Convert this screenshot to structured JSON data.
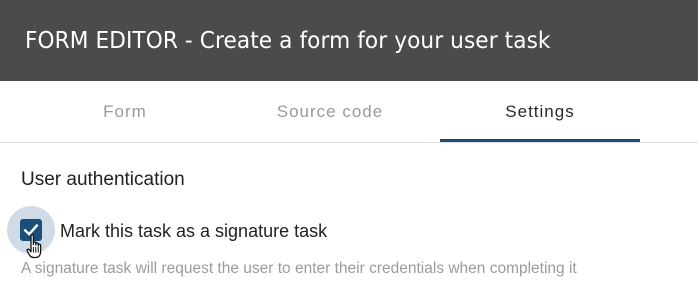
{
  "header": {
    "title": "FORM EDITOR - Create a form for your user task"
  },
  "tabs": [
    {
      "label": "Form",
      "active": false
    },
    {
      "label": "Source code",
      "active": false
    },
    {
      "label": "Settings",
      "active": true
    }
  ],
  "settings": {
    "section_title": "User authentication",
    "signature_checkbox": {
      "label": "Mark this task as a signature task",
      "checked": true,
      "helper": "A signature task will request the user to enter their credentials when completing it"
    }
  },
  "colors": {
    "header_bg": "#4b4b4b",
    "accent": "#1c4e7a",
    "halo": "#cfdbe6",
    "inactive_tab": "#9a9a9a"
  },
  "icons": {
    "checkbox": "check-icon",
    "pointer": "hand-pointer-icon"
  }
}
